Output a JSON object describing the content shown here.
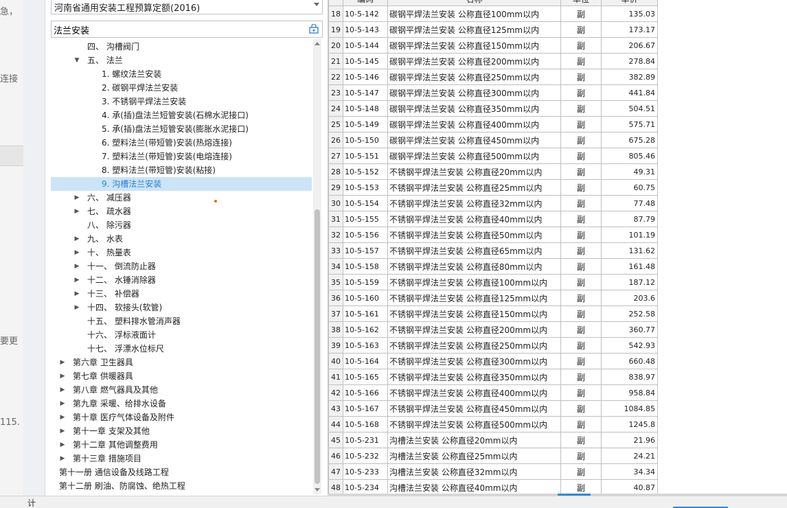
{
  "left_fragments": {
    "f1": "急，",
    "f2": "连接",
    "f3": "要更",
    "f4": "115."
  },
  "quota_library": {
    "selected": "河南省通用安装工程预算定额(2016)"
  },
  "search": {
    "value": "法兰安装",
    "icon": "search-filter-icon"
  },
  "tree": {
    "items": [
      {
        "label": "四、 沟槽阀门",
        "indent": 3,
        "toggle": ""
      },
      {
        "label": "五、 法兰",
        "indent": 3,
        "toggle": "▼"
      },
      {
        "label": "1. 螺纹法兰安装",
        "indent": 4,
        "toggle": ""
      },
      {
        "label": "2. 碳钢平焊法兰安装",
        "indent": 4,
        "toggle": ""
      },
      {
        "label": "3. 不锈钢平焊法兰安装",
        "indent": 4,
        "toggle": ""
      },
      {
        "label": "4. 承(插)盘法兰短管安装(石棉水泥接口)",
        "indent": 4,
        "toggle": ""
      },
      {
        "label": "5. 承(插)盘法兰短管安装(膨胀水泥接口)",
        "indent": 4,
        "toggle": ""
      },
      {
        "label": "6. 塑料法兰(带短管)安装(热熔连接)",
        "indent": 4,
        "toggle": ""
      },
      {
        "label": "7. 塑料法兰(带短管)安装(电熔连接)",
        "indent": 4,
        "toggle": ""
      },
      {
        "label": "8. 塑料法兰(带短管)安装(粘接)",
        "indent": 4,
        "toggle": ""
      },
      {
        "label": "9. 沟槽法兰安装",
        "indent": 4,
        "toggle": "",
        "selected": true
      },
      {
        "label": "六、 减压器",
        "indent": 3,
        "toggle": "▶"
      },
      {
        "label": "七、 疏水器",
        "indent": 3,
        "toggle": "▶"
      },
      {
        "label": "八、 除污器",
        "indent": 3,
        "toggle": ""
      },
      {
        "label": "九、 水表",
        "indent": 3,
        "toggle": "▶"
      },
      {
        "label": "十、 热量表",
        "indent": 3,
        "toggle": "▶"
      },
      {
        "label": "十一、 倒流防止器",
        "indent": 3,
        "toggle": "▶"
      },
      {
        "label": "十二、 水锤消除器",
        "indent": 3,
        "toggle": "▶"
      },
      {
        "label": "十三、 补偿器",
        "indent": 3,
        "toggle": "▶"
      },
      {
        "label": "十四、 软接头(软管)",
        "indent": 3,
        "toggle": "▶"
      },
      {
        "label": "十五、 塑料排水管消声器",
        "indent": 3,
        "toggle": ""
      },
      {
        "label": "十六、 浮标液面计",
        "indent": 3,
        "toggle": ""
      },
      {
        "label": "十七、 浮漂水位标尺",
        "indent": 3,
        "toggle": ""
      },
      {
        "label": "第六章 卫生器具",
        "indent": 2,
        "toggle": "▶"
      },
      {
        "label": "第七章 供暖器具",
        "indent": 2,
        "toggle": "▶"
      },
      {
        "label": "第八章 燃气器具及其他",
        "indent": 2,
        "toggle": "▶"
      },
      {
        "label": "第九章 采暖、给排水设备",
        "indent": 2,
        "toggle": "▶"
      },
      {
        "label": "第十章 医疗气体设备及附件",
        "indent": 2,
        "toggle": "▶"
      },
      {
        "label": "第十一章 支架及其他",
        "indent": 2,
        "toggle": "▶"
      },
      {
        "label": "第十二章 其他调整费用",
        "indent": 2,
        "toggle": "▶"
      },
      {
        "label": "第十三章 措施项目",
        "indent": 2,
        "toggle": "▶"
      },
      {
        "label": "第十一册 通信设备及线路工程",
        "indent": 1,
        "toggle": "▶"
      },
      {
        "label": "第十二册 刷油、防腐蚀、绝热工程",
        "indent": 1,
        "toggle": "▶"
      }
    ]
  },
  "table": {
    "headers": [
      "",
      "编码",
      "名称",
      "单位",
      "单价"
    ],
    "rows": [
      [
        "18",
        "10-5-142",
        "碳钢平焊法兰安装 公称直径100mm以内",
        "副",
        "135.03"
      ],
      [
        "19",
        "10-5-143",
        "碳钢平焊法兰安装 公称直径125mm以内",
        "副",
        "173.17"
      ],
      [
        "20",
        "10-5-144",
        "碳钢平焊法兰安装 公称直径150mm以内",
        "副",
        "206.67"
      ],
      [
        "21",
        "10-5-145",
        "碳钢平焊法兰安装 公称直径200mm以内",
        "副",
        "278.84"
      ],
      [
        "22",
        "10-5-146",
        "碳钢平焊法兰安装 公称直径250mm以内",
        "副",
        "382.89"
      ],
      [
        "23",
        "10-5-147",
        "碳钢平焊法兰安装 公称直径300mm以内",
        "副",
        "441.84"
      ],
      [
        "24",
        "10-5-148",
        "碳钢平焊法兰安装 公称直径350mm以内",
        "副",
        "504.51"
      ],
      [
        "25",
        "10-5-149",
        "碳钢平焊法兰安装 公称直径400mm以内",
        "副",
        "575.71"
      ],
      [
        "26",
        "10-5-150",
        "碳钢平焊法兰安装 公称直径450mm以内",
        "副",
        "675.28"
      ],
      [
        "27",
        "10-5-151",
        "碳钢平焊法兰安装 公称直径500mm以内",
        "副",
        "805.46"
      ],
      [
        "28",
        "10-5-152",
        "不锈钢平焊法兰安装 公称直径20mm以内",
        "副",
        "49.31"
      ],
      [
        "29",
        "10-5-153",
        "不锈钢平焊法兰安装 公称直径25mm以内",
        "副",
        "60.75"
      ],
      [
        "30",
        "10-5-154",
        "不锈钢平焊法兰安装 公称直径32mm以内",
        "副",
        "77.48"
      ],
      [
        "31",
        "10-5-155",
        "不锈钢平焊法兰安装 公称直径40mm以内",
        "副",
        "87.79"
      ],
      [
        "32",
        "10-5-156",
        "不锈钢平焊法兰安装 公称直径50mm以内",
        "副",
        "101.19"
      ],
      [
        "33",
        "10-5-157",
        "不锈钢平焊法兰安装 公称直径65mm以内",
        "副",
        "131.62"
      ],
      [
        "34",
        "10-5-158",
        "不锈钢平焊法兰安装 公称直径80mm以内",
        "副",
        "161.48"
      ],
      [
        "35",
        "10-5-159",
        "不锈钢平焊法兰安装 公称直径100mm以内",
        "副",
        "187.12"
      ],
      [
        "36",
        "10-5-160",
        "不锈钢平焊法兰安装 公称直径125mm以内",
        "副",
        "203.6"
      ],
      [
        "37",
        "10-5-161",
        "不锈钢平焊法兰安装 公称直径150mm以内",
        "副",
        "252.58"
      ],
      [
        "38",
        "10-5-162",
        "不锈钢平焊法兰安装 公称直径200mm以内",
        "副",
        "360.77"
      ],
      [
        "39",
        "10-5-163",
        "不锈钢平焊法兰安装 公称直径250mm以内",
        "副",
        "542.93"
      ],
      [
        "40",
        "10-5-164",
        "不锈钢平焊法兰安装 公称直径300mm以内",
        "副",
        "660.48"
      ],
      [
        "41",
        "10-5-165",
        "不锈钢平焊法兰安装 公称直径350mm以内",
        "副",
        "838.97"
      ],
      [
        "42",
        "10-5-166",
        "不锈钢平焊法兰安装 公称直径400mm以内",
        "副",
        "958.84"
      ],
      [
        "43",
        "10-5-167",
        "不锈钢平焊法兰安装 公称直径450mm以内",
        "副",
        "1084.85"
      ],
      [
        "44",
        "10-5-168",
        "不锈钢平焊法兰安装 公称直径500mm以内",
        "副",
        "1245.8"
      ],
      [
        "45",
        "10-5-231",
        "沟槽法兰安装 公称直径20mm以内",
        "副",
        "21.96"
      ],
      [
        "46",
        "10-5-232",
        "沟槽法兰安装 公称直径25mm以内",
        "副",
        "24.21"
      ],
      [
        "47",
        "10-5-233",
        "沟槽法兰安装 公称直径32mm以内",
        "副",
        "34.34"
      ],
      [
        "48",
        "10-5-234",
        "沟槽法兰安装 公称直径40mm以内",
        "副",
        "40.87"
      ]
    ]
  },
  "bottom_bar": {
    "label": "计"
  },
  "colors": {
    "selection_bg": "#cce4f7",
    "selection_text": "#2a7fd4",
    "accent_blue": "#2b8be0",
    "dot": "#f0641e"
  }
}
